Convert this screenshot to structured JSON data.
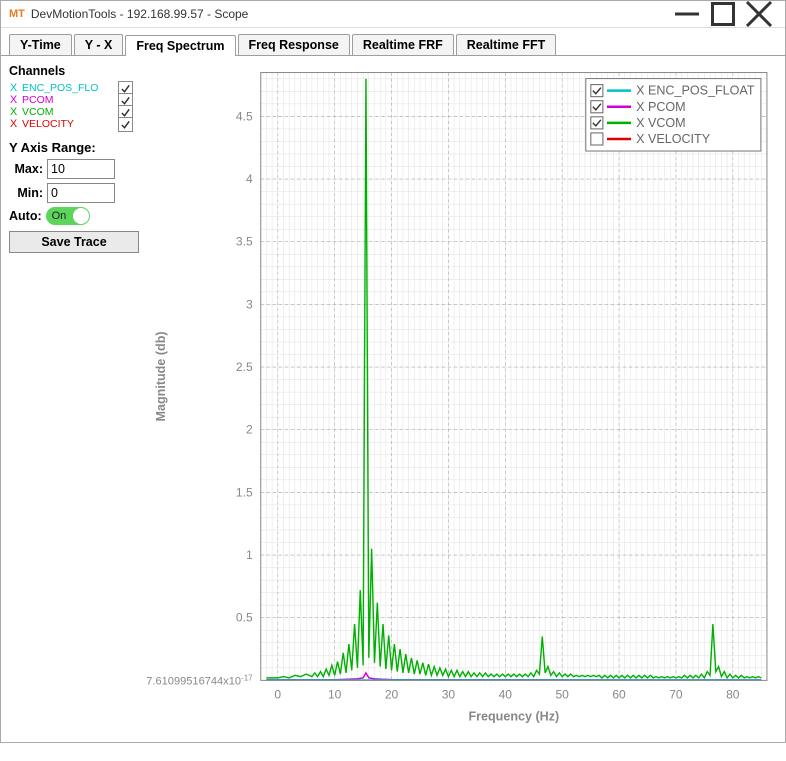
{
  "app_logo": "MT",
  "window_title": "DevMotionTools - 192.168.99.57 - Scope",
  "tabs": {
    "items": [
      "Y-Time",
      "Y - X",
      "Freq Spectrum",
      "Freq Response",
      "Realtime FRF",
      "Realtime FFT"
    ],
    "active": "Freq Spectrum"
  },
  "sidebar": {
    "channels_title": "Channels",
    "channels": [
      {
        "color": "#00c3c3",
        "label": "ENC_POS_FLOAT",
        "display": "ENC_POS_FLO",
        "checked": true
      },
      {
        "color": "#d400d4",
        "label": "PCOM",
        "display": "PCOM",
        "checked": true
      },
      {
        "color": "#00b000",
        "label": "VCOM",
        "display": "VCOM",
        "checked": true
      },
      {
        "color": "#e00000",
        "label": "VELOCITY",
        "display": "VELOCITY",
        "checked": true
      }
    ],
    "yrange_title": "Y Axis Range:",
    "max_label": "Max:",
    "max_value": "10",
    "min_label": "Min:",
    "min_value": "0",
    "auto_label": "Auto:",
    "auto_on_text": "On",
    "save_trace_label": "Save Trace"
  },
  "legend": {
    "items": [
      {
        "label": "X ENC_POS_FLOAT",
        "color": "#00c3c3",
        "checked": true
      },
      {
        "label": "X PCOM",
        "color": "#d400d4",
        "checked": true
      },
      {
        "label": "X VCOM",
        "color": "#00b000",
        "checked": true
      },
      {
        "label": "X VELOCITY",
        "color": "#e00000",
        "checked": false
      }
    ]
  },
  "chart_data": {
    "type": "line",
    "xlabel": "Frequency (Hz)",
    "ylabel": "Magnitude (db)",
    "xlim": [
      -3,
      86
    ],
    "ylim_label_min": "7.61099516744x10",
    "ylim_label_min_exp": "-17",
    "ylim": [
      0,
      4.85
    ],
    "x_ticks": [
      0,
      10,
      20,
      30,
      40,
      50,
      60,
      70,
      80
    ],
    "y_ticks": [
      0.5,
      1,
      1.5,
      2,
      2.5,
      3,
      3.5,
      4,
      4.5
    ],
    "series": [
      {
        "name": "X VCOM",
        "color": "#00b000",
        "points": [
          [
            -2,
            0.02
          ],
          [
            0,
            0.02
          ],
          [
            1,
            0.03
          ],
          [
            2,
            0.02
          ],
          [
            3,
            0.04
          ],
          [
            4,
            0.03
          ],
          [
            5,
            0.05
          ],
          [
            6,
            0.03
          ],
          [
            6.5,
            0.06
          ],
          [
            7,
            0.03
          ],
          [
            7.5,
            0.07
          ],
          [
            8,
            0.03
          ],
          [
            8.5,
            0.09
          ],
          [
            9,
            0.04
          ],
          [
            9.5,
            0.12
          ],
          [
            10,
            0.04
          ],
          [
            10.5,
            0.15
          ],
          [
            11,
            0.05
          ],
          [
            11.5,
            0.22
          ],
          [
            12,
            0.06
          ],
          [
            12.5,
            0.29
          ],
          [
            13,
            0.08
          ],
          [
            13.5,
            0.45
          ],
          [
            14,
            0.1
          ],
          [
            14.5,
            0.72
          ],
          [
            15,
            0.12
          ],
          [
            15.5,
            4.8
          ],
          [
            16,
            0.18
          ],
          [
            16.5,
            1.05
          ],
          [
            17,
            0.14
          ],
          [
            17.5,
            0.62
          ],
          [
            18,
            0.11
          ],
          [
            18.5,
            0.45
          ],
          [
            19,
            0.09
          ],
          [
            19.5,
            0.36
          ],
          [
            20,
            0.08
          ],
          [
            20.5,
            0.29
          ],
          [
            21,
            0.07
          ],
          [
            21.5,
            0.25
          ],
          [
            22,
            0.06
          ],
          [
            22.5,
            0.21
          ],
          [
            23,
            0.06
          ],
          [
            23.5,
            0.18
          ],
          [
            24,
            0.05
          ],
          [
            24.5,
            0.16
          ],
          [
            25,
            0.05
          ],
          [
            25.5,
            0.14
          ],
          [
            26,
            0.04
          ],
          [
            26.5,
            0.13
          ],
          [
            27,
            0.04
          ],
          [
            27.5,
            0.11
          ],
          [
            28,
            0.04
          ],
          [
            28.5,
            0.1
          ],
          [
            29,
            0.04
          ],
          [
            29.5,
            0.09
          ],
          [
            30,
            0.03
          ],
          [
            30.5,
            0.08
          ],
          [
            31,
            0.03
          ],
          [
            31.5,
            0.08
          ],
          [
            32,
            0.03
          ],
          [
            32.5,
            0.07
          ],
          [
            33,
            0.03
          ],
          [
            33.5,
            0.07
          ],
          [
            34,
            0.03
          ],
          [
            34.5,
            0.06
          ],
          [
            35,
            0.03
          ],
          [
            35.5,
            0.06
          ],
          [
            36,
            0.03
          ],
          [
            36.5,
            0.06
          ],
          [
            37,
            0.03
          ],
          [
            37.5,
            0.05
          ],
          [
            38,
            0.03
          ],
          [
            38.5,
            0.05
          ],
          [
            39,
            0.03
          ],
          [
            39.5,
            0.05
          ],
          [
            40,
            0.03
          ],
          [
            40.5,
            0.05
          ],
          [
            41,
            0.03
          ],
          [
            41.5,
            0.05
          ],
          [
            42,
            0.03
          ],
          [
            42.5,
            0.05
          ],
          [
            43,
            0.03
          ],
          [
            43.5,
            0.05
          ],
          [
            44,
            0.03
          ],
          [
            44.5,
            0.06
          ],
          [
            45,
            0.03
          ],
          [
            45.5,
            0.08
          ],
          [
            46,
            0.05
          ],
          [
            46.5,
            0.35
          ],
          [
            47,
            0.06
          ],
          [
            47.5,
            0.11
          ],
          [
            48,
            0.04
          ],
          [
            48.5,
            0.07
          ],
          [
            49,
            0.03
          ],
          [
            49.5,
            0.06
          ],
          [
            50,
            0.03
          ],
          [
            50.5,
            0.05
          ],
          [
            51,
            0.03
          ],
          [
            51.5,
            0.05
          ],
          [
            52,
            0.03
          ],
          [
            52.5,
            0.04
          ],
          [
            53,
            0.03
          ],
          [
            53.5,
            0.04
          ],
          [
            54,
            0.03
          ],
          [
            54.5,
            0.04
          ],
          [
            55,
            0.03
          ],
          [
            55.5,
            0.04
          ],
          [
            56,
            0.03
          ],
          [
            56.5,
            0.04
          ],
          [
            57,
            0.02
          ],
          [
            57.5,
            0.04
          ],
          [
            58,
            0.02
          ],
          [
            58.5,
            0.04
          ],
          [
            59,
            0.02
          ],
          [
            59.5,
            0.04
          ],
          [
            60,
            0.02
          ],
          [
            60.5,
            0.04
          ],
          [
            61,
            0.02
          ],
          [
            61.5,
            0.04
          ],
          [
            62,
            0.02
          ],
          [
            62.5,
            0.04
          ],
          [
            63,
            0.02
          ],
          [
            63.5,
            0.04
          ],
          [
            64,
            0.02
          ],
          [
            64.5,
            0.04
          ],
          [
            65,
            0.02
          ],
          [
            65.5,
            0.04
          ],
          [
            66,
            0.02
          ],
          [
            66.5,
            0.03
          ],
          [
            67,
            0.02
          ],
          [
            67.5,
            0.03
          ],
          [
            68,
            0.02
          ],
          [
            68.5,
            0.03
          ],
          [
            69,
            0.02
          ],
          [
            69.5,
            0.03
          ],
          [
            70,
            0.02
          ],
          [
            70.5,
            0.03
          ],
          [
            71,
            0.02
          ],
          [
            71.5,
            0.04
          ],
          [
            72,
            0.02
          ],
          [
            72.5,
            0.04
          ],
          [
            73,
            0.02
          ],
          [
            73.5,
            0.04
          ],
          [
            74,
            0.02
          ],
          [
            74.5,
            0.05
          ],
          [
            75,
            0.02
          ],
          [
            75.5,
            0.07
          ],
          [
            76,
            0.04
          ],
          [
            76.5,
            0.45
          ],
          [
            77,
            0.07
          ],
          [
            77.5,
            0.11
          ],
          [
            78,
            0.03
          ],
          [
            78.5,
            0.07
          ],
          [
            79,
            0.02
          ],
          [
            79.5,
            0.05
          ],
          [
            80,
            0.02
          ],
          [
            80.5,
            0.04
          ],
          [
            81,
            0.02
          ],
          [
            81.5,
            0.04
          ],
          [
            82,
            0.02
          ],
          [
            82.5,
            0.03
          ],
          [
            83,
            0.02
          ],
          [
            83.5,
            0.03
          ],
          [
            84,
            0.02
          ],
          [
            84.5,
            0.03
          ],
          [
            85,
            0.02
          ]
        ]
      },
      {
        "name": "X PCOM",
        "color": "#d400d4",
        "points": [
          [
            -2,
            0.005
          ],
          [
            10,
            0.005
          ],
          [
            14,
            0.012
          ],
          [
            15,
            0.02
          ],
          [
            15.5,
            0.06
          ],
          [
            16,
            0.02
          ],
          [
            17,
            0.012
          ],
          [
            20,
            0.006
          ],
          [
            85,
            0.004
          ]
        ]
      },
      {
        "name": "X ENC_POS_FLOAT",
        "color": "#00c3c3",
        "points": [
          [
            -2,
            0.003
          ],
          [
            85,
            0.003
          ]
        ]
      }
    ]
  }
}
